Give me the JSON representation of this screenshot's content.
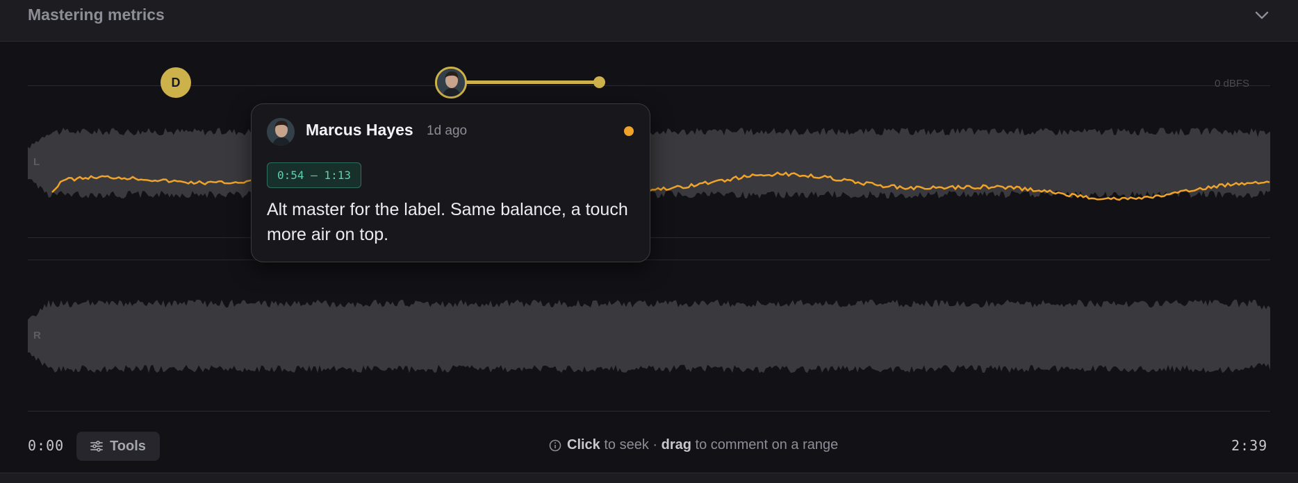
{
  "header": {
    "title": "Mastering metrics"
  },
  "waveform": {
    "scale_label": "0 dBFS",
    "channels": [
      {
        "label": "L"
      },
      {
        "label": "R"
      }
    ],
    "loudness_curve_color": "#f0a32a",
    "waveform_color": "#3a3a3e"
  },
  "markers": [
    {
      "type": "initial",
      "initial": "D",
      "color": "#cdb14a"
    },
    {
      "type": "avatar",
      "author": "Marcus Hayes",
      "color": "#cdb14a"
    }
  ],
  "comment": {
    "author": "Marcus Hayes",
    "time_ago": "1d ago",
    "range": "0:54 – 1:13",
    "text": "Alt master for the label. Same balance, a touch more air on top.",
    "unread_color": "#f0a32a"
  },
  "footer": {
    "current_time": "0:00",
    "duration": "2:39",
    "tools_label": "Tools",
    "hint_click": "Click",
    "hint_seek": "to seek ·",
    "hint_drag": "drag",
    "hint_rest": "to comment on a range"
  }
}
